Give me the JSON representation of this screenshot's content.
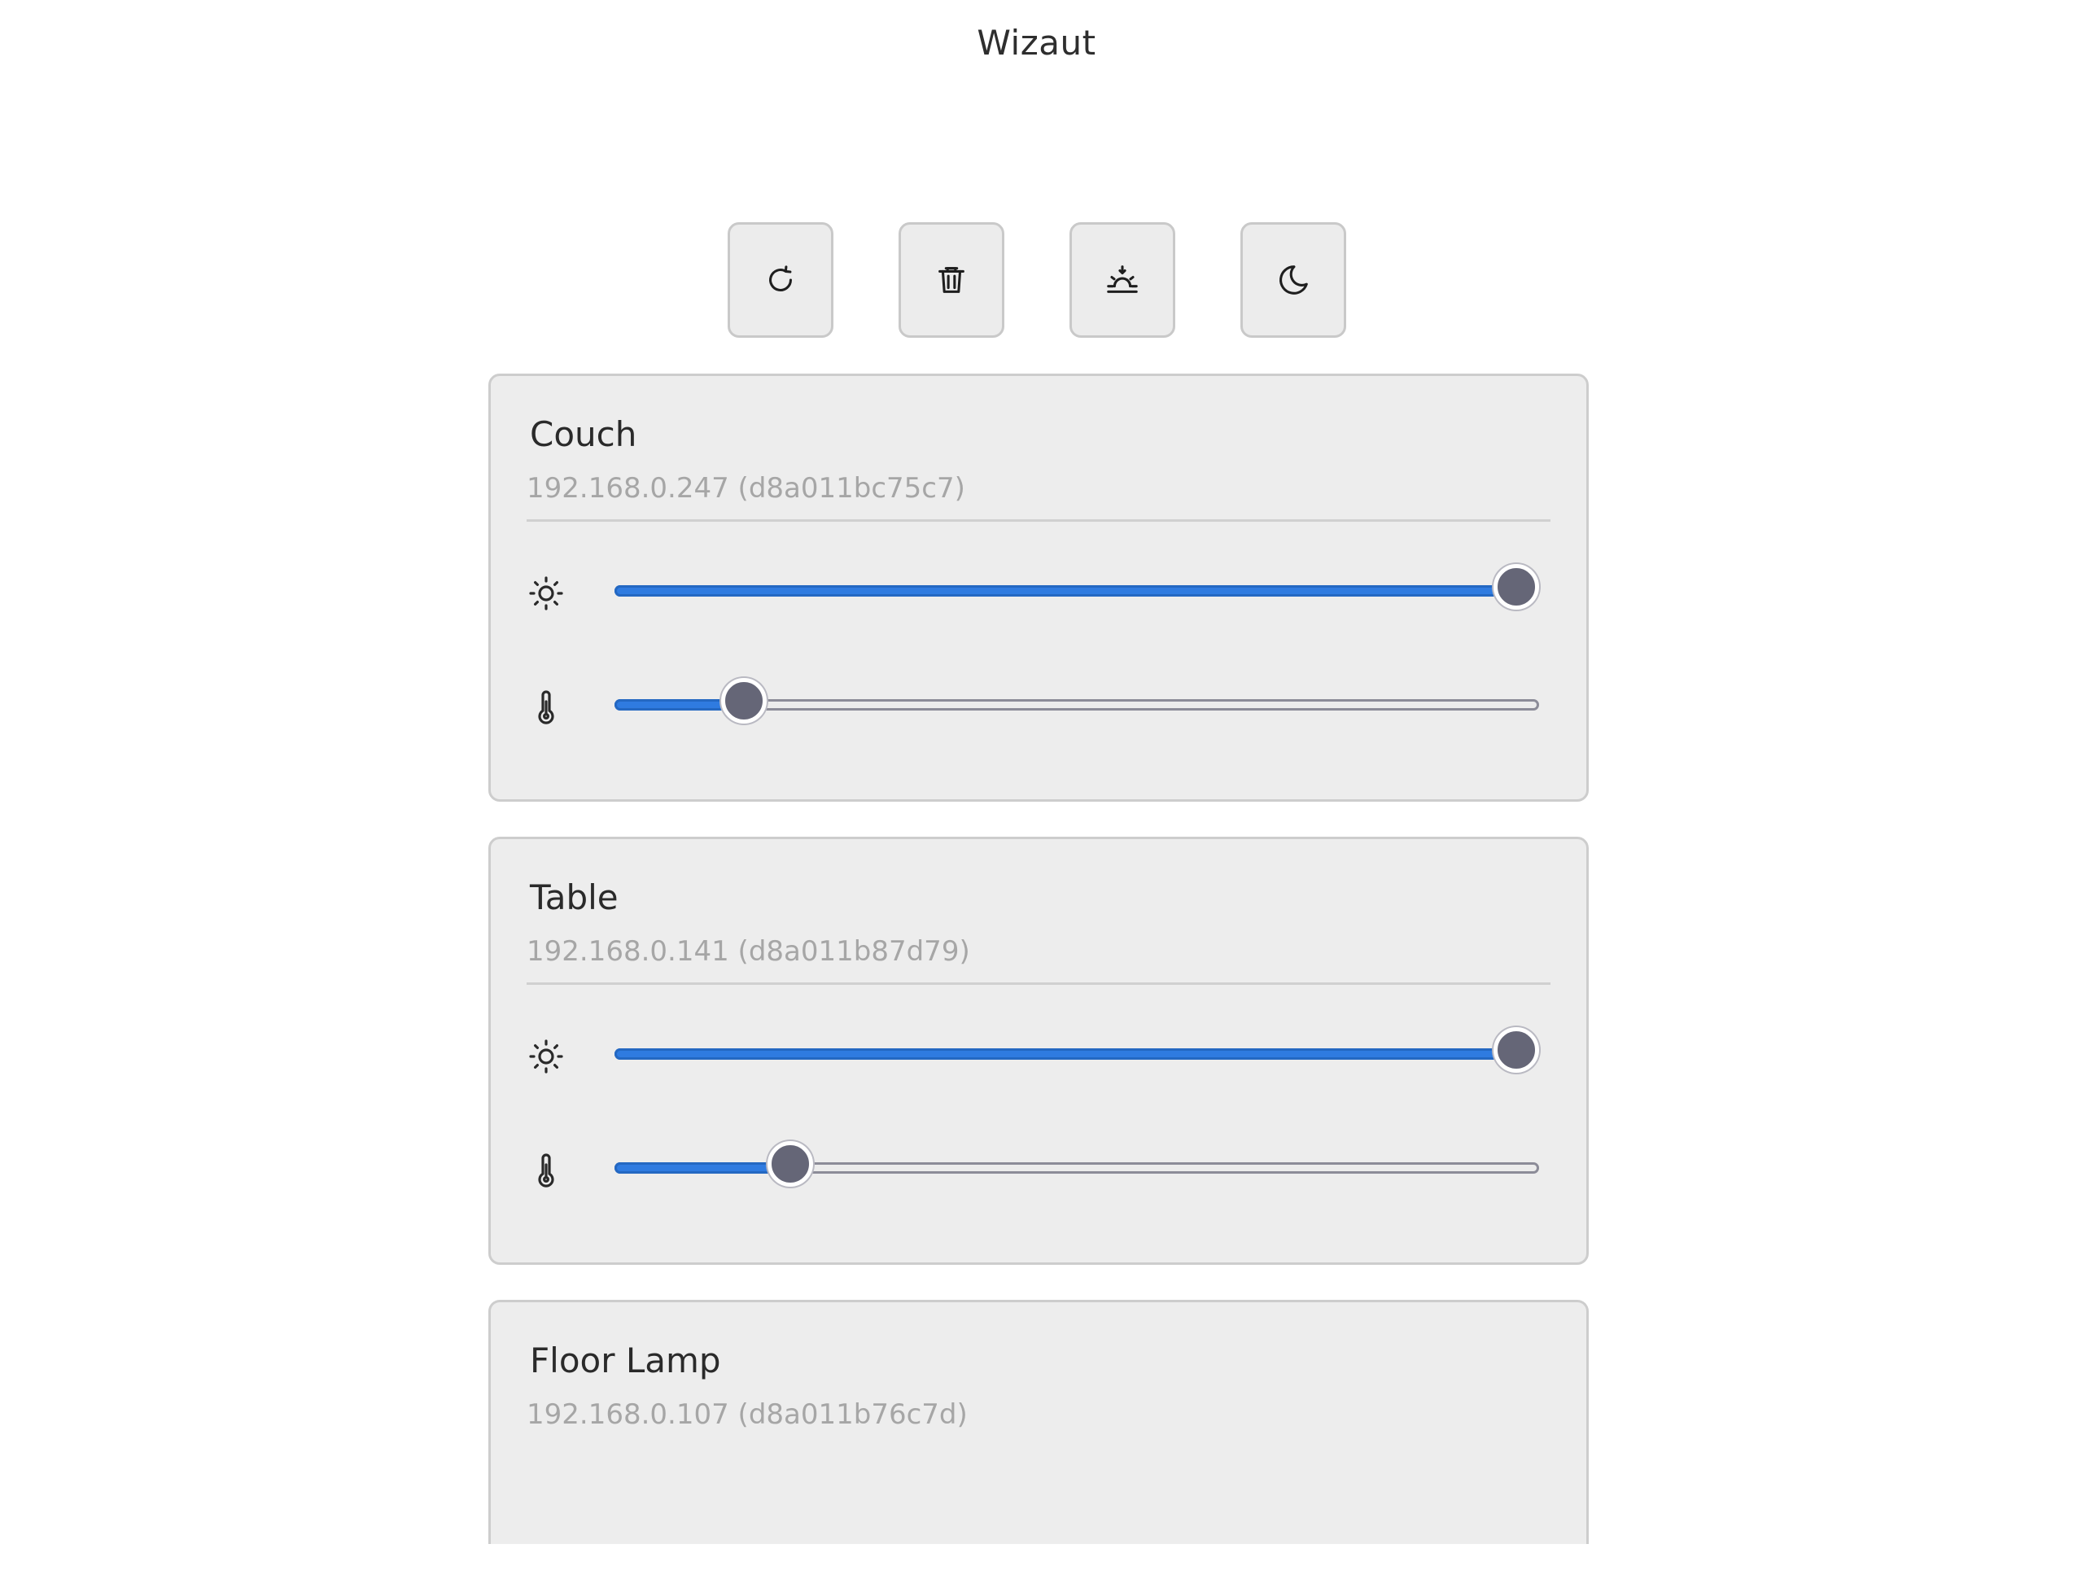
{
  "app": {
    "title": "Wizaut"
  },
  "toolbar": {
    "buttons": [
      {
        "id": "refresh",
        "icon": "refresh-icon"
      },
      {
        "id": "delete",
        "icon": "trash-icon"
      },
      {
        "id": "sunrise",
        "icon": "sunrise-icon"
      },
      {
        "id": "night",
        "icon": "moon-icon"
      }
    ]
  },
  "colors": {
    "accent": "#2f7be0",
    "thumb": "#656677",
    "card_bg": "#ededed",
    "subtitle": "#a6a6a6"
  },
  "devices": [
    {
      "name": "Couch",
      "address": "192.168.0.247 (d8a011bc75c7)",
      "brightness_fraction": 1.0,
      "temperature_fraction": 0.14
    },
    {
      "name": "Table",
      "address": "192.168.0.141 (d8a011b87d79)",
      "brightness_fraction": 1.0,
      "temperature_fraction": 0.19
    },
    {
      "name": "Floor Lamp",
      "address": "192.168.0.107 (d8a011b76c7d)"
    }
  ]
}
